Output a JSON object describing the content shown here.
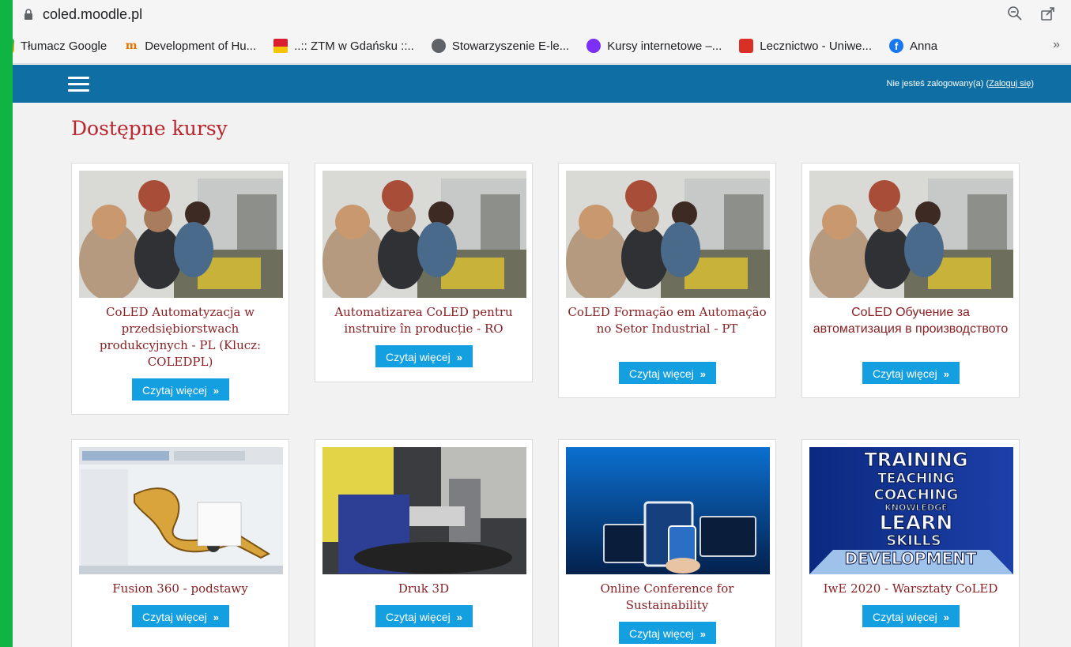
{
  "browser": {
    "url": "coled.moodle.pl",
    "bookmarks": [
      {
        "label": "Tłumacz Google",
        "icon": "google-translate-icon",
        "color": "#4285f4"
      },
      {
        "label": "Development of Hu...",
        "icon": "tn-logo-icon",
        "color": "#e37400"
      },
      {
        "label": "..:: ZTM w Gdańsku ::..",
        "icon": "ztm-icon",
        "color": "#d81e2f"
      },
      {
        "label": "Stowarzyszenie E-le...",
        "icon": "globe-icon",
        "color": "#5f6368"
      },
      {
        "label": "Kursy internetowe –...",
        "icon": "courses-icon",
        "color": "#7b2ff7"
      },
      {
        "label": "Lecznictwo - Uniwe...",
        "icon": "lock-red-icon",
        "color": "#d93025"
      },
      {
        "label": "Anna",
        "icon": "facebook-icon",
        "color": "#1877f2"
      }
    ],
    "more": "»"
  },
  "navbar": {
    "login_text": "Nie jesteś zalogowany(a) (",
    "login_link": "Zaloguj się",
    "login_end": ")"
  },
  "page": {
    "title": "Dostępne kursy"
  },
  "courses": [
    {
      "title": "CoLED Automatyzacja w przedsiębiorstwach produkcyjnych - PL (Klucz: COLEDPL)",
      "button": "Czytaj więcej"
    },
    {
      "title": "Automatizarea CoLED pentru instruire în producție - RO",
      "button": "Czytaj więcej"
    },
    {
      "title": "CoLED Formação em Automação no Setor Industrial - PT",
      "button": "Czytaj więcej"
    },
    {
      "title": "CoLED Обучение за автоматизация в производството",
      "button": "Czytaj więcej"
    },
    {
      "title": "Fusion 360 - podstawy",
      "button": "Czytaj więcej"
    },
    {
      "title": "Druk 3D",
      "button": "Czytaj więcej"
    },
    {
      "title": "Online Conference for Sustainability",
      "button": "Czytaj więcej"
    },
    {
      "title": "IwE 2020 - Warsztaty CoLED",
      "button": "Czytaj więcej"
    }
  ],
  "training_image_words": [
    "TRAINING",
    "TEACHING",
    "COACHING",
    "KNOWLEDGE",
    "LEARN",
    "SKILLS",
    "DEVELOPMENT"
  ],
  "colors": {
    "navbar": "#0f6fa5",
    "title": "#b9262e",
    "button": "#149fe1",
    "background_border": "#0fb443"
  }
}
